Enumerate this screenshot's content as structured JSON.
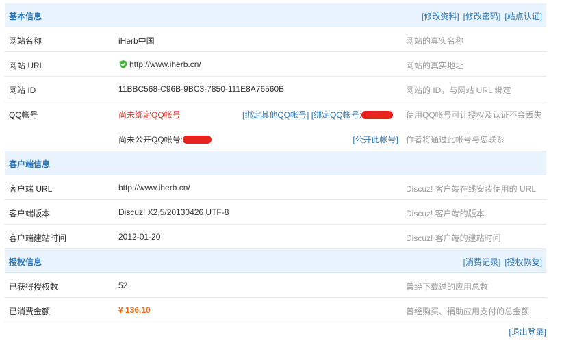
{
  "basic": {
    "title": "基本信息",
    "actions": [
      "[修改资料]",
      "[修改密码]",
      "[站点认证]"
    ],
    "rows": {
      "name": {
        "label": "网站名称",
        "value": "iHerb中国",
        "desc": "网站的真实名称"
      },
      "url": {
        "label": "网站 URL",
        "value": "http://www.iherb.cn/",
        "desc": "网站的真实地址"
      },
      "id": {
        "label": "网站 ID",
        "value": "11BBC568-C96B-9BC3-7850-111E8A76560B",
        "desc": "网站的 ID，与网站 URL 绑定"
      },
      "qq": {
        "label": "QQ帐号",
        "status": "尚未绑定QQ帐号",
        "bind_other": "[绑定其他QQ帐号]",
        "bound_prefix": "[绑定QQ帐号:",
        "desc": "使用QQ帐号可让授权及认证不会丢失"
      },
      "qq_public": {
        "status": "尚未公开QQ帐号:",
        "action": "[公开此帐号]",
        "desc": "作者将通过此帐号与您联系"
      }
    }
  },
  "client": {
    "title": "客户端信息",
    "rows": [
      {
        "label": "客户端 URL",
        "value": "http://www.iherb.cn/",
        "desc": "Discuz! 客户端在线安装使用的 URL"
      },
      {
        "label": "客户端版本",
        "value": "Discuz! X2.5/20130426 UTF-8",
        "desc": "Discuz! 客户端的版本"
      },
      {
        "label": "客户端建站时间",
        "value": "2012-01-20",
        "desc": "Discuz! 客户端的建站时间"
      }
    ]
  },
  "auth": {
    "title": "授权信息",
    "actions": [
      "[消费记录]",
      "[授权恢复]"
    ],
    "rows": [
      {
        "label": "已获得授权数",
        "value": "52",
        "desc": "曾经下载过的应用总数"
      },
      {
        "label": "已消费金额",
        "value": "¥ 136.10",
        "desc": "曾经购买、捐助应用支付的总金额"
      }
    ]
  },
  "footer": {
    "logout": "[退出登录]"
  },
  "colors": {
    "accent": "#2a76b8",
    "header_bg": "#e8f3fd",
    "warning": "#e0352b",
    "money": "#f26a1b"
  },
  "icons": {
    "verified": "shield-check-icon"
  }
}
